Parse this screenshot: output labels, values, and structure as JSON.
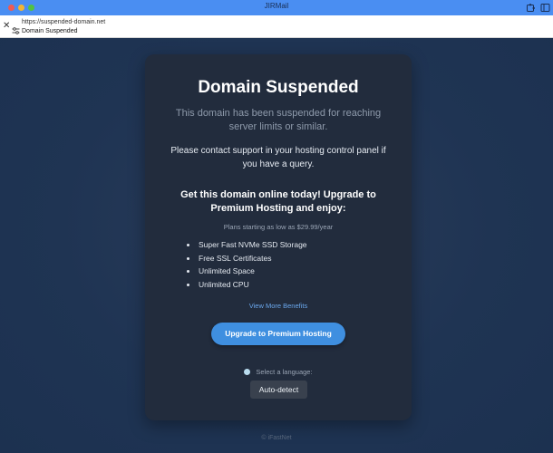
{
  "window": {
    "app_title": "JIRMail"
  },
  "urlbar": {
    "url": "https://suspended-domain.net",
    "page_title": "Domain Suspended"
  },
  "card": {
    "title": "Domain Suspended",
    "subtitle": "This domain has been suspended for reaching server limits or similar.",
    "contact": "Please contact support in your hosting control panel if you have a query.",
    "promo": "Get this domain online today! Upgrade to Premium Hosting and enjoy:",
    "price": "Plans starting as low as $29.99/year",
    "features": [
      "Super Fast NVMe SSD Storage",
      "Free SSL Certificates",
      "Unlimited Space",
      "Unlimited CPU"
    ],
    "more_link": "View More Benefits",
    "upgrade_button": "Upgrade to Premium Hosting",
    "language_label": "Select a language:",
    "language_value": "Auto-detect"
  },
  "footer": {
    "text": "© iFastNet"
  },
  "icons": {
    "titlebar_right": [
      "puzzle-icon",
      "sidebar-icon"
    ],
    "urlbar_left": [
      "close-icon",
      "site-settings-icon"
    ]
  },
  "colors": {
    "titlebar": "#4a8ef2",
    "card_bg": "#222c3d",
    "page_bg": "#1f3552",
    "accent_button": "#3f8fe0",
    "link": "#6aa7ec"
  }
}
